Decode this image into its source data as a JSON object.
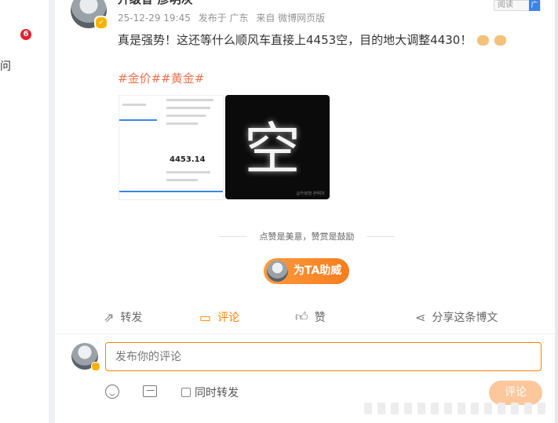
{
  "sidebar": {
    "badge_count": "6",
    "cut_text": "问"
  },
  "post": {
    "username": "升级智·彦明灰",
    "meta": {
      "time": "25-12-29 19:45",
      "location": "发布于 广东",
      "source": "来自 微博网页版"
    },
    "top_button": "阅读",
    "ad_label": "广",
    "text": "真是强势！这还等什么顺风车直接上4453空，目的地大调整4430！",
    "hashtags": "#金价##黄金#",
    "image1_price": "4453.14",
    "image2_glyph": "空",
    "image2_watermark": "@升级智·彦明灰"
  },
  "support": {
    "slogan": "点赞是美意，赞赏是鼓励",
    "button_label": "为TA助威"
  },
  "actions": {
    "repost": "转发",
    "comment": "评论",
    "like": "赞",
    "share": "分享这条博文"
  },
  "comment_box": {
    "placeholder": "发布你的评论",
    "repost_label": "同时转发",
    "submit_label": "评论"
  },
  "colors": {
    "accent": "#ff8200",
    "hashtag": "#eb7350",
    "badge": "#e0242f"
  }
}
